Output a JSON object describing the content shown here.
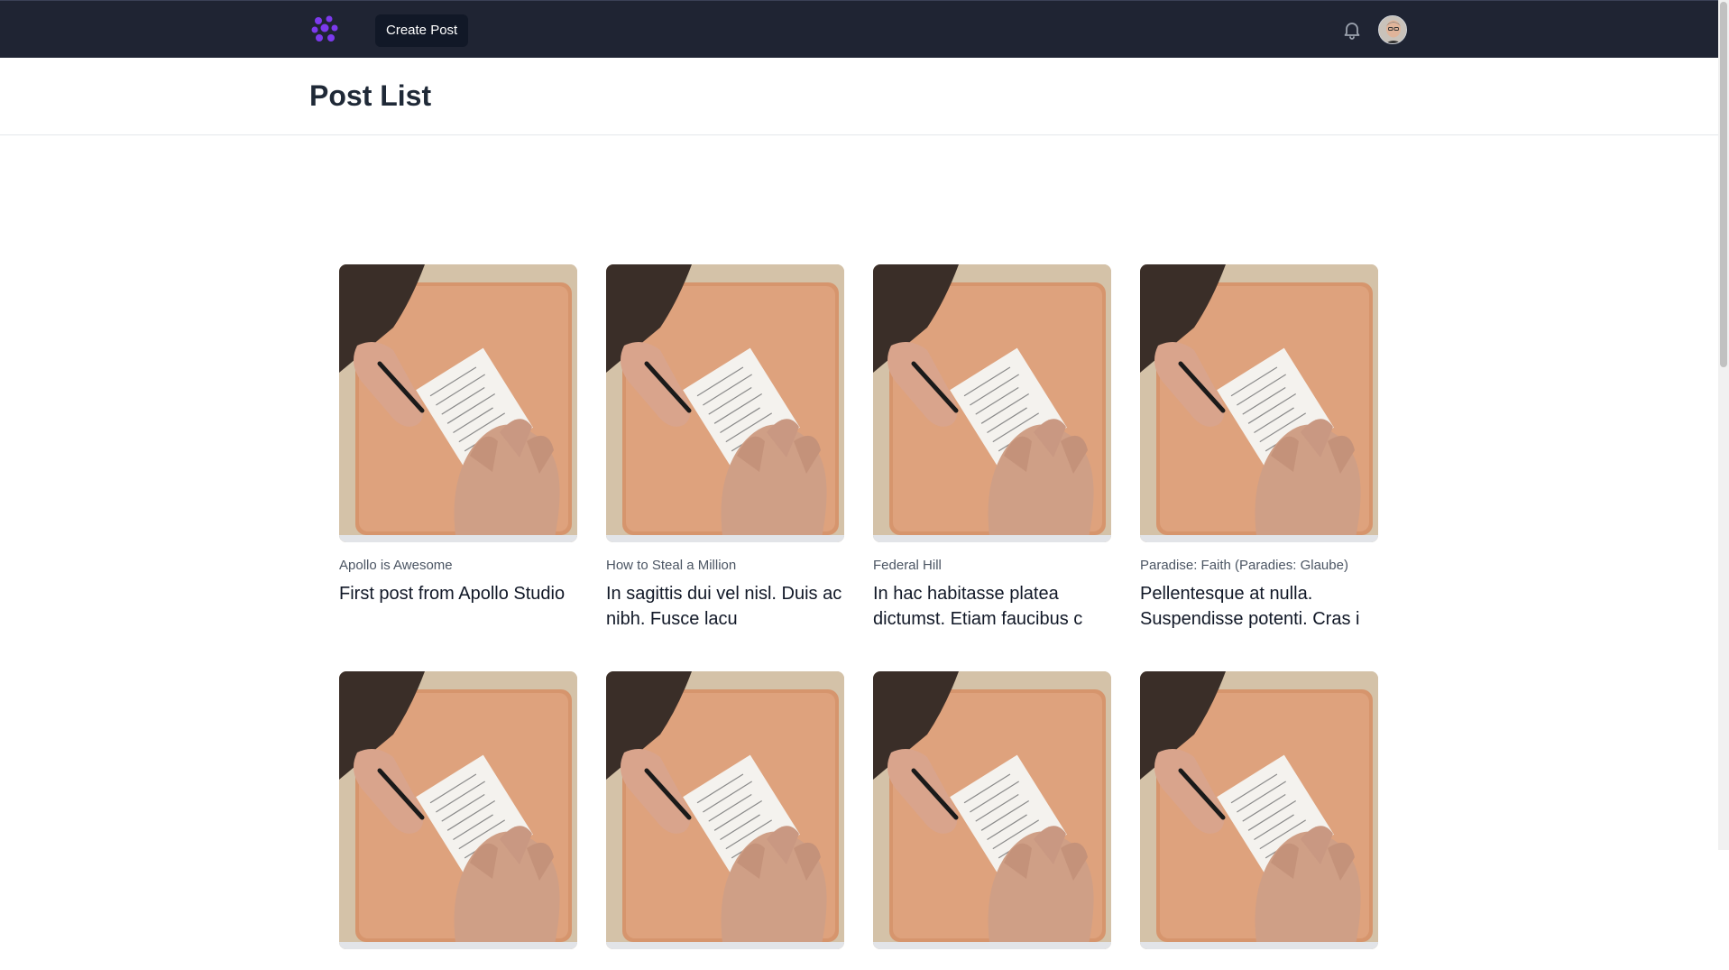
{
  "nav": {
    "logo_icon": "purple-dots-logo-icon",
    "create_post_label": "Create Post",
    "notification_icon": "bell-icon",
    "avatar_icon": "user-avatar"
  },
  "header": {
    "title": "Post List"
  },
  "posts": [
    {
      "category": "Apollo is Awesome",
      "title": "First post from Apollo Studio"
    },
    {
      "category": "How to Steal a Million",
      "title": "In sagittis dui vel nisl. Duis ac nibh. Fusce lacu"
    },
    {
      "category": "Federal Hill",
      "title": "In hac habitasse platea dictumst. Etiam faucibus c"
    },
    {
      "category": "Paradise: Faith (Paradies: Glaube)",
      "title": "Pellentesque at nulla. Suspendisse potenti. Cras i"
    },
    {
      "category": "",
      "title": ""
    },
    {
      "category": "",
      "title": ""
    },
    {
      "category": "",
      "title": ""
    },
    {
      "category": "",
      "title": ""
    }
  ],
  "colors": {
    "navbar_bg": "#1f2433",
    "logo_purple": "#7c3aed",
    "button_bg": "#111827"
  }
}
